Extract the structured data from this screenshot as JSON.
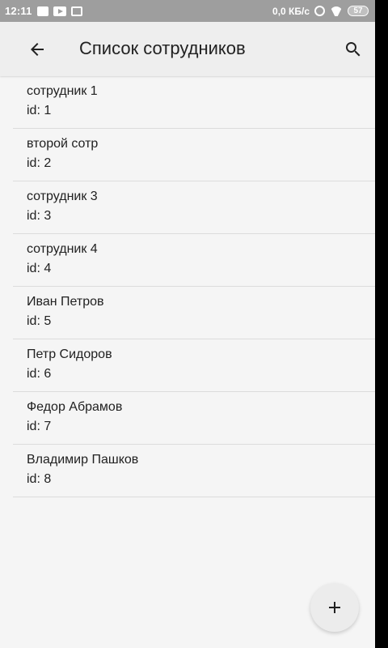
{
  "status_bar": {
    "time": "12:11",
    "network_speed": "0,0 КБ/с",
    "battery_level": "57",
    "icons": [
      "notification-icon",
      "youtube-icon",
      "outlined-notification-icon",
      "alarm-icon",
      "wifi-icon",
      "battery-icon"
    ]
  },
  "app_bar": {
    "title": "Список сотрудников",
    "back_icon": "arrow-left-icon",
    "search_icon": "search-icon"
  },
  "employees": [
    {
      "name": "сотрудник 1",
      "id_label": "id: 1"
    },
    {
      "name": "второй сотр",
      "id_label": "id: 2"
    },
    {
      "name": "сотрудник 3",
      "id_label": "id: 3"
    },
    {
      "name": "сотрудник 4",
      "id_label": "id: 4"
    },
    {
      "name": "Иван Петров",
      "id_label": "id: 5"
    },
    {
      "name": "Петр Сидоров",
      "id_label": "id: 6"
    },
    {
      "name": "Федор Абрамов",
      "id_label": "id: 7"
    },
    {
      "name": "Владимир Пашков",
      "id_label": "id: 8"
    }
  ],
  "fab": {
    "icon": "plus-icon"
  },
  "colors": {
    "status_bar_bg": "#9e9e9e",
    "app_bar_bg": "#eeeeee",
    "background": "#f5f5f5",
    "text": "#212121",
    "divider": "#dcdcdc"
  }
}
